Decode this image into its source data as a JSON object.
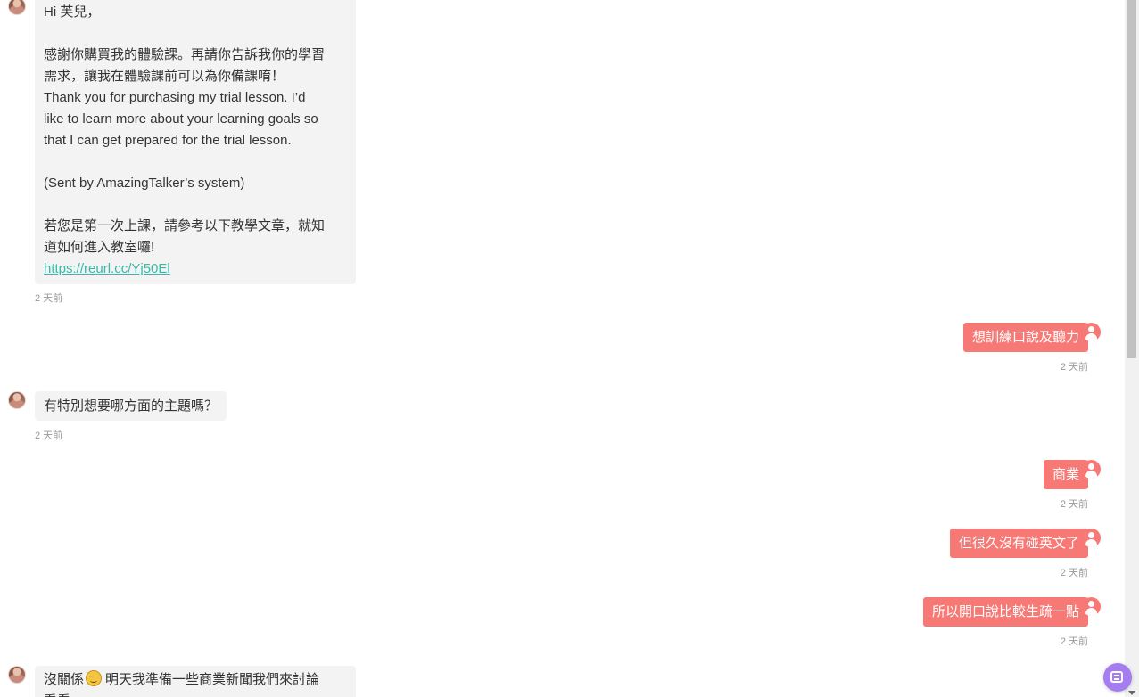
{
  "messages": {
    "m1": {
      "greeting": "Hi 芙兒，",
      "zh_line1": "感謝你購買我的體驗課。再請你告訴我你的學習",
      "zh_line2": "需求，讓我在體驗課前可以為你備課唷！",
      "en_line1": "Thank you for purchasing my trial lesson. I’d",
      "en_line2": "like to learn more about your learning goals so",
      "en_line3": "that I can get prepared for the trial lesson.",
      "system_note": "(Sent by AmazingTalker’s system)",
      "guide_line1": "若您是第一次上課，請參考以下教學文章，就知",
      "guide_line2": "道如何進入教室囉!",
      "link": "https://reurl.cc/Yj50El",
      "time": "2 天前"
    },
    "m2": {
      "text": "想訓練口說及聽力",
      "time": "2 天前"
    },
    "m3": {
      "text": "有特別想要哪方面的主題嗎？",
      "time": "2 天前"
    },
    "m4": {
      "text": "商業",
      "time": "2 天前"
    },
    "m5": {
      "text": "但很久沒有碰英文了",
      "time": "2 天前"
    },
    "m6": {
      "text": "所以開口說比較生疏一點",
      "time": "2 天前"
    },
    "m7": {
      "text_before": "沒關係",
      "emoji": "smiling-face",
      "text_after": "明天我準備一些商業新聞我們來討論",
      "text_line2": "看看"
    }
  },
  "colors": {
    "outgoing_bubble": "#f77975",
    "incoming_bubble": "#f3f3f3",
    "link": "#3ab8a8",
    "float_button": "#a57df1"
  },
  "icons": {
    "tutor_avatar": "tutor-avatar",
    "user_icon": "user-circle-icon",
    "float_button": "chat-list-icon"
  }
}
